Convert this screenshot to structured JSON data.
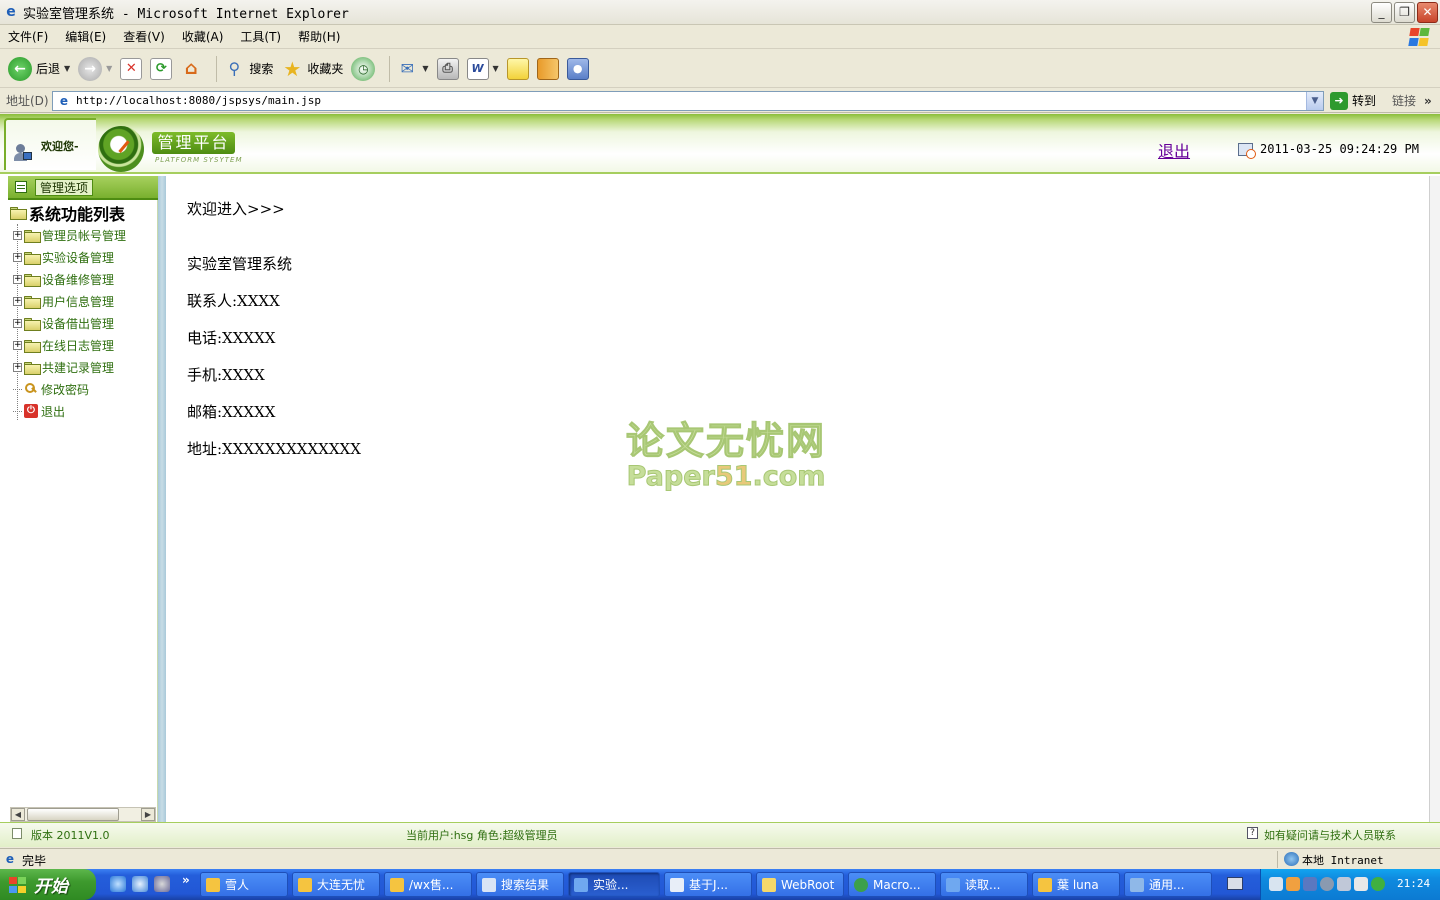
{
  "window": {
    "title": "实验室管理系统 - Microsoft Internet Explorer",
    "buttons": {
      "minimize": "_",
      "maximize": "❐",
      "close": "✕"
    }
  },
  "menubar": {
    "items": [
      "文件(F)",
      "编辑(E)",
      "查看(V)",
      "收藏(A)",
      "工具(T)",
      "帮助(H)"
    ]
  },
  "toolbar": {
    "back_label": "后退",
    "search_label": "搜索",
    "favorites_label": "收藏夹"
  },
  "addressbar": {
    "label": "地址(D)",
    "url": "http://localhost:8080/jspsys/main.jsp",
    "go_label": "转到",
    "links_label": "链接"
  },
  "header": {
    "welcome": "欢迎您-",
    "logo_text": "管理平台",
    "logo_subtext": "PLATFORM SYSYTEM",
    "logout_label": "退出",
    "datetime": "2011-03-25 09:24:29 PM"
  },
  "sidebar": {
    "header_label": "管理选项",
    "root_label": "系统功能列表",
    "items": [
      {
        "label": "管理员帐号管理",
        "type": "folder"
      },
      {
        "label": "实验设备管理",
        "type": "folder"
      },
      {
        "label": "设备维修管理",
        "type": "folder"
      },
      {
        "label": "用户信息管理",
        "type": "folder"
      },
      {
        "label": "设备借出管理",
        "type": "folder"
      },
      {
        "label": "在线日志管理",
        "type": "folder"
      },
      {
        "label": "共建记录管理",
        "type": "folder"
      },
      {
        "label": "修改密码",
        "type": "key"
      },
      {
        "label": "退出",
        "type": "exit"
      }
    ]
  },
  "content": {
    "greeting": "欢迎进入>>>",
    "system_name": "实验室管理系统",
    "contact": "联系人:XXXX",
    "phone": "电话:XXXXX",
    "mobile": "手机:XXXX",
    "email": "邮箱:XXXXX",
    "address": "地址:XXXXXXXXXXXXX",
    "watermark_line1": "论文无忧网",
    "watermark_line2a": "Paper",
    "watermark_line2b": "51",
    "watermark_line2c": ".com"
  },
  "footer": {
    "version": "版本 2011V1.0",
    "current_user": "当前用户:hsg  角色:超级管理员",
    "help": "如有疑问请与技术人员联系"
  },
  "statusbar": {
    "status": "完毕",
    "zone": "本地 Intranet"
  },
  "taskbar": {
    "start_label": "开始",
    "tasks": [
      {
        "label": "雪人",
        "color": "#F5C440"
      },
      {
        "label": "大连无忧",
        "color": "#F5C440"
      },
      {
        "label": "/wx售...",
        "color": "#F5C440"
      },
      {
        "label": "搜索结果",
        "color": "#D9E4F5"
      },
      {
        "label": "实验...",
        "color": "#6FA8F0"
      },
      {
        "label": "基于J...",
        "color": "#E8EEF8"
      },
      {
        "label": "WebRoot",
        "color": "#F5D86A"
      },
      {
        "label": "Macro...",
        "color": "#3CA04A"
      },
      {
        "label": "读取...",
        "color": "#6FA8F0"
      },
      {
        "label": "葉 luna",
        "color": "#F5C440"
      },
      {
        "label": "通用...",
        "color": "#8FB8E8"
      }
    ],
    "clock": "21:24"
  },
  "colors": {
    "accent_green": "#79B02E",
    "link_purple": "#660099",
    "taskbar_blue": "#245EDB"
  }
}
